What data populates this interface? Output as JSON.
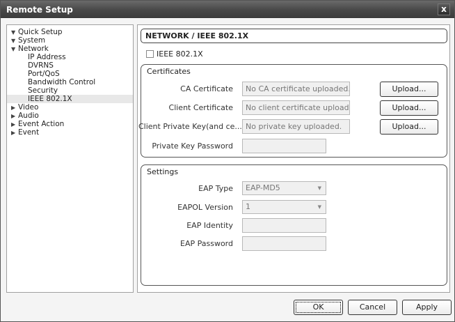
{
  "window": {
    "title": "Remote Setup",
    "close_label": "x"
  },
  "tree": {
    "items": [
      {
        "arrow": "▼",
        "label": "Quick Setup"
      },
      {
        "arrow": "▼",
        "label": "System"
      },
      {
        "arrow": "▼",
        "label": "Network"
      }
    ],
    "network_children": [
      {
        "label": "IP Address"
      },
      {
        "label": "DVRNS"
      },
      {
        "label": "Port/QoS"
      },
      {
        "label": "Bandwidth Control"
      },
      {
        "label": "Security"
      },
      {
        "label": "IEEE 802.1X"
      }
    ],
    "items_after": [
      {
        "arrow": "▶",
        "label": "Video"
      },
      {
        "arrow": "▶",
        "label": "Audio"
      },
      {
        "arrow": "▶",
        "label": "Event Action"
      },
      {
        "arrow": "▶",
        "label": "Event"
      }
    ]
  },
  "content": {
    "header": "NETWORK / IEEE 802.1X",
    "ieee_checkbox_label": "IEEE 802.1X",
    "certificates": {
      "title": "Certificates",
      "ca_label": "CA Certificate",
      "ca_value": "No CA certificate uploaded.",
      "client_label": "Client Certificate",
      "client_value": "No client certificate uploaded.",
      "key_label": "Client Private Key(and ce...",
      "key_value": "No private key uploaded.",
      "password_label": "Private Key Password",
      "password_value": "",
      "upload_label": "Upload..."
    },
    "settings": {
      "title": "Settings",
      "eap_type_label": "EAP Type",
      "eap_type_value": "EAP-MD5",
      "eapol_label": "EAPOL Version",
      "eapol_value": "1",
      "identity_label": "EAP Identity",
      "identity_value": "",
      "password_label": "EAP Password",
      "password_value": ""
    }
  },
  "footer": {
    "ok": "OK",
    "cancel": "Cancel",
    "apply": "Apply"
  }
}
